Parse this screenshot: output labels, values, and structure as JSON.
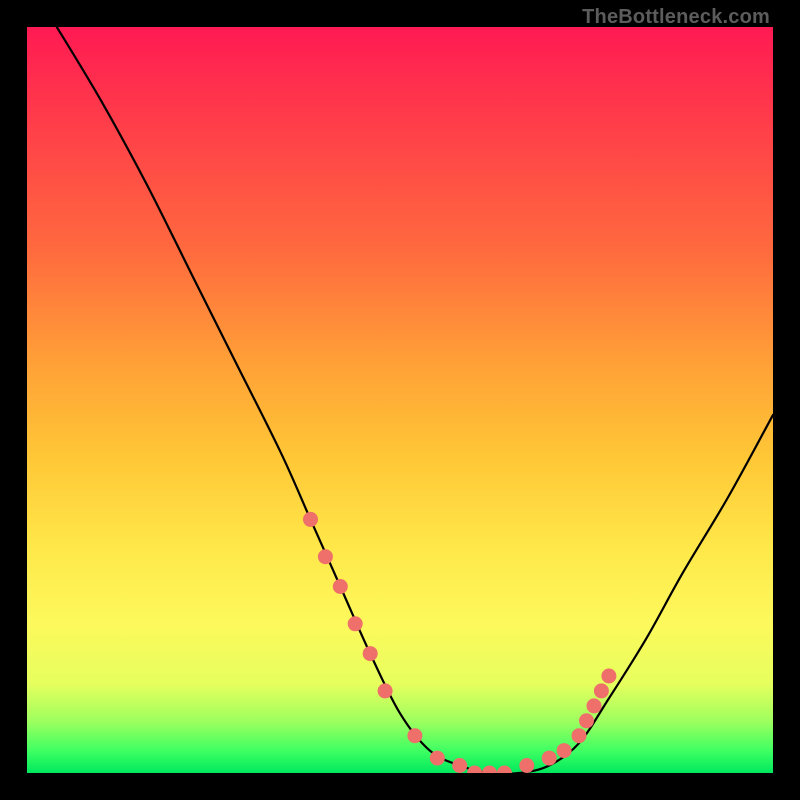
{
  "attribution": "TheBottleneck.com",
  "chart_data": {
    "type": "line",
    "title": "",
    "xlabel": "",
    "ylabel": "",
    "xlim": [
      0,
      100
    ],
    "ylim": [
      0,
      100
    ],
    "series": [
      {
        "name": "bottleneck-curve",
        "x": [
          4,
          10,
          16,
          22,
          28,
          34,
          38,
          42,
          46,
          50,
          54,
          58,
          62,
          66,
          70,
          74,
          78,
          83,
          88,
          94,
          100
        ],
        "y": [
          100,
          90,
          79,
          67,
          55,
          43,
          34,
          25,
          16,
          8,
          3,
          1,
          0,
          0,
          1,
          4,
          10,
          18,
          27,
          37,
          48
        ]
      }
    ],
    "markers": {
      "name": "highlight-dots",
      "color": "#ef6f6a",
      "x": [
        38,
        40,
        42,
        44,
        46,
        48,
        52,
        55,
        58,
        60,
        62,
        64,
        67,
        70,
        72,
        74,
        75,
        76,
        77,
        78
      ],
      "y": [
        34,
        29,
        25,
        20,
        16,
        11,
        5,
        2,
        1,
        0,
        0,
        0,
        1,
        2,
        3,
        5,
        7,
        9,
        11,
        13
      ]
    }
  }
}
